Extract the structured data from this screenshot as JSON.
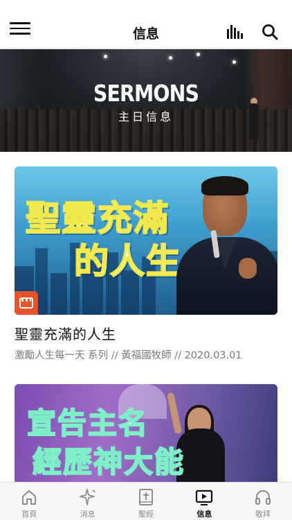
{
  "header": {
    "title": "信息",
    "menu_icon": "hamburger-menu-icon",
    "audio_icon": "audio-bars-icon",
    "search_icon": "search-icon"
  },
  "hero": {
    "heading": "SERMONS",
    "subheading": "主日信息"
  },
  "sermons": [
    {
      "thumb_text_line1": "聖靈充滿",
      "thumb_text_line2": "的人生",
      "title": "聖靈充滿的人生",
      "meta": "激勵人生每一天 系列 // 黃福國牧師 // 2020.03.01"
    },
    {
      "thumb_text_line1": "宣告主名",
      "thumb_text_line2": "經歷神大能"
    }
  ],
  "tabbar": {
    "items": [
      {
        "label": "首頁",
        "icon": "home-icon",
        "active": false
      },
      {
        "label": "消息",
        "icon": "sparkle-icon",
        "active": false
      },
      {
        "label": "聖經",
        "icon": "bible-icon",
        "active": false
      },
      {
        "label": "信息",
        "icon": "play-video-icon",
        "active": true
      },
      {
        "label": "敬拜",
        "icon": "headphones-icon",
        "active": false
      }
    ]
  },
  "colors": {
    "accent": "#e8532a",
    "text_primary": "#111111",
    "text_secondary": "#7b7b7b",
    "tab_inactive": "#8c8c8c"
  }
}
